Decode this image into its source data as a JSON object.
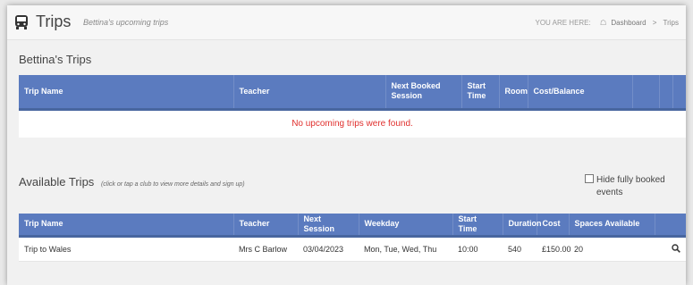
{
  "header": {
    "title": "Trips",
    "subtitle": "Bettina's upcoming trips",
    "breadcrumb_label": "YOU ARE HERE:",
    "breadcrumbs": [
      "Dashboard",
      "Trips"
    ]
  },
  "my_trips": {
    "title": "Bettina's Trips",
    "columns": [
      "Trip Name",
      "Teacher",
      "Next Booked Session",
      "Start Time",
      "Room",
      "Cost/Balance"
    ],
    "empty_message": "No upcoming trips were found."
  },
  "available": {
    "title": "Available Trips",
    "note": "(click or tap a club to view more details and sign up)",
    "hide_full_label": "Hide fully booked events",
    "hide_full_checked": false,
    "columns": [
      "Trip Name",
      "Teacher",
      "Next Session",
      "Weekday",
      "Start Time",
      "Duration",
      "Cost",
      "Spaces Available"
    ],
    "rows": [
      {
        "trip_name": "Trip to Wales",
        "teacher": "Mrs C Barlow",
        "next_session": "03/04/2023",
        "weekday": "Mon, Tue, Wed, Thu",
        "start_time": "10:00",
        "duration": "540",
        "cost": "£150.00",
        "spaces": "20"
      }
    ]
  },
  "colors": {
    "header_blue": "#5b7bbf",
    "empty_red": "#e0302e"
  },
  "icons": {
    "title": "bus-icon",
    "home": "home-icon",
    "row_action": "search-icon"
  }
}
